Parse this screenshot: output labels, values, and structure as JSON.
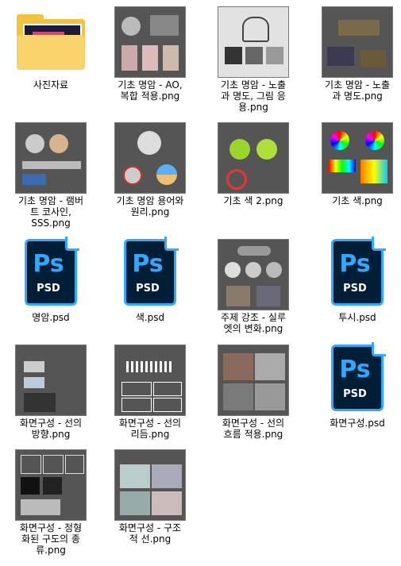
{
  "files": [
    {
      "name": "사진자료",
      "type": "folder"
    },
    {
      "name": "기초 명암 - AO, 복합 적용.png",
      "type": "png"
    },
    {
      "name": "기초 명암 - 노출과 명도, 그림 응용.png",
      "type": "png"
    },
    {
      "name": "기초 명암 - 노출과 명도.png",
      "type": "png"
    },
    {
      "name": "기초 명암 - 램버트 코사인, SSS.png",
      "type": "png"
    },
    {
      "name": "기초 명암 용어와 원리.png",
      "type": "png"
    },
    {
      "name": "기초 색 2.png",
      "type": "png"
    },
    {
      "name": "기초 색.png",
      "type": "png"
    },
    {
      "name": "명암.psd",
      "type": "psd"
    },
    {
      "name": "색.psd",
      "type": "psd"
    },
    {
      "name": "주제 강조 - 실루엣의 변화.png",
      "type": "png"
    },
    {
      "name": "투시.psd",
      "type": "psd"
    },
    {
      "name": "화면구성 - 선의 방향.png",
      "type": "png"
    },
    {
      "name": "화면구성 - 선의 리듬.png",
      "type": "png"
    },
    {
      "name": "화면구성 - 선의 흐름 적용.png",
      "type": "png"
    },
    {
      "name": "화면구성.psd",
      "type": "psd"
    },
    {
      "name": "화면구성 - 정형화된 구도의 종류.png",
      "type": "png"
    },
    {
      "name": "화면구성 - 구조적 선.png",
      "type": "png"
    }
  ],
  "labels": [
    "사진자료",
    "기초 명암 - AO,\n복합 적용.png",
    "기초 명암 - 노출\n과 명도, 그림 응\n용.png",
    "기초 명암 - 노출\n과 명도.png",
    "기초 명암 - 램버\n트 코사인,\nSSS.png",
    "기초 명암 용어와\n원리.png",
    "기초 색 2.png",
    "기초 색.png",
    "명암.psd",
    "색.psd",
    "주제 강조 - 실루\n엣의 변화.png",
    "투시.psd",
    "화면구성 - 선의\n방향.png",
    "화면구성 - 선의\n리듬.png",
    "화면구성 - 선의\n흐름 적용.png",
    "화면구성.psd",
    "화면구성 - 정형\n화된 구도의 종\n류.png",
    "화면구성 - 구조\n적 선.png"
  ],
  "psd_icon": {
    "glyph": "Ps",
    "ext": "PSD"
  },
  "colors": {
    "psd_bg": "#001e36",
    "psd_accent": "#31a8ff",
    "folder": "#f2c241",
    "thumb_bg": "#555555"
  }
}
